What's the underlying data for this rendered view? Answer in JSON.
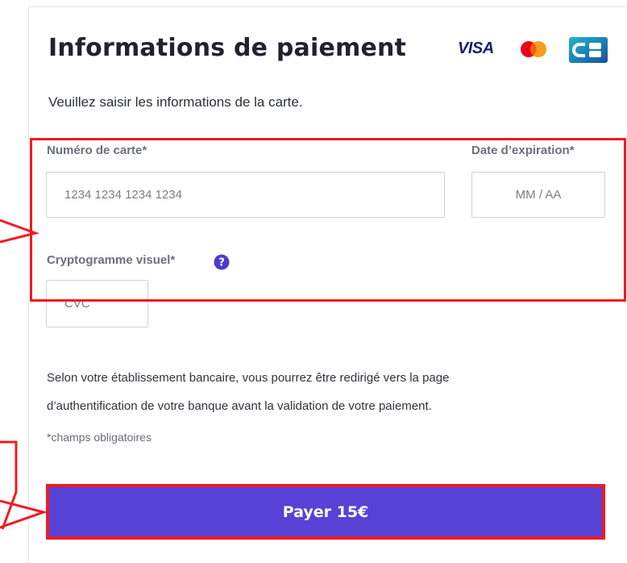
{
  "payment": {
    "title": "Informations de paiement",
    "subtitle": "Veuillez saisir les informations de la carte.",
    "logos": {
      "visa": "VISA",
      "mastercard": "mastercard-logo",
      "cb": "cb-logo"
    },
    "card_number": {
      "label": "Numéro de carte*",
      "placeholder": "1234 1234 1234 1234"
    },
    "expiry": {
      "label": "Date d’expiration*",
      "placeholder": "MM / AA"
    },
    "cvc": {
      "label": "Cryptogramme visuel*",
      "placeholder": "CVC",
      "help_icon": "question-circle-icon"
    },
    "notice_line1": "Selon votre établissement bancaire, vous pourrez être redirigé vers la page",
    "notice_line2": "d’authentification de votre banque avant la validation de votre paiement.",
    "required_note": "*champs obligatoires",
    "pay_button": "Payer 15€"
  },
  "colors": {
    "accent": "#5643d6",
    "highlight": "#ee1b24",
    "title": "#20232d",
    "label": "#6b6f7a",
    "field_border": "#cfd1d7"
  }
}
